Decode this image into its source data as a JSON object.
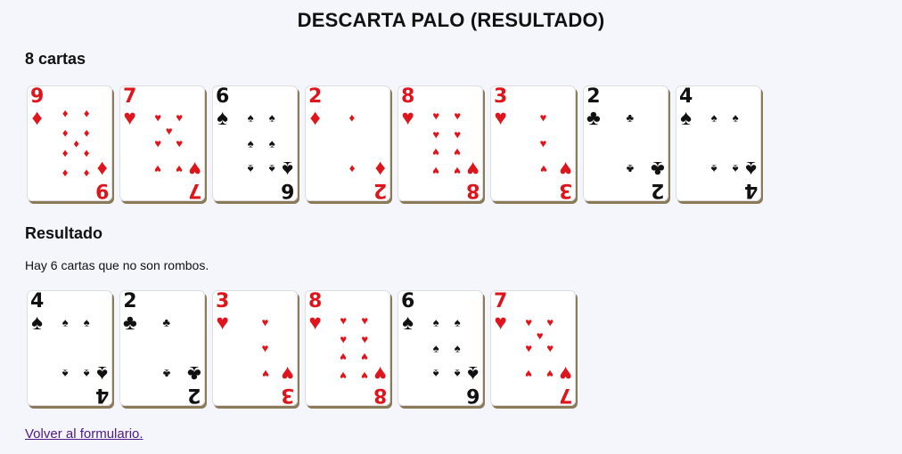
{
  "title": "DESCARTA PALO (RESULTADO)",
  "cards_heading": "8 cartas",
  "result_heading": "Resultado",
  "summary": "Hay 6 cartas que no son rombos.",
  "back_link": "Volver al formulario.",
  "suit_symbols": {
    "diamonds": "♦",
    "hearts": "♥",
    "spades": "♠",
    "clubs": "♣"
  },
  "colors": {
    "red": "#e0141b",
    "black": "#111111",
    "link": "#4b1b8a"
  },
  "cards": [
    {
      "rank": "9",
      "suit": "diamonds"
    },
    {
      "rank": "7",
      "suit": "hearts"
    },
    {
      "rank": "6",
      "suit": "spades"
    },
    {
      "rank": "2",
      "suit": "diamonds"
    },
    {
      "rank": "8",
      "suit": "hearts"
    },
    {
      "rank": "3",
      "suit": "hearts"
    },
    {
      "rank": "2",
      "suit": "clubs"
    },
    {
      "rank": "4",
      "suit": "spades"
    }
  ],
  "result_cards": [
    {
      "rank": "4",
      "suit": "spades"
    },
    {
      "rank": "2",
      "suit": "clubs"
    },
    {
      "rank": "3",
      "suit": "hearts"
    },
    {
      "rank": "8",
      "suit": "hearts"
    },
    {
      "rank": "6",
      "suit": "spades"
    },
    {
      "rank": "7",
      "suit": "hearts"
    }
  ]
}
